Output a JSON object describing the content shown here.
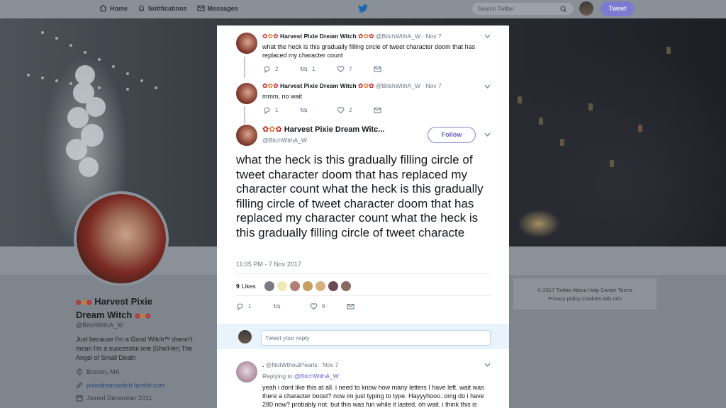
{
  "nav": {
    "home": "Home",
    "notifications": "Notifications",
    "messages": "Messages",
    "search_placeholder": "Search Twitter",
    "tweet_button": "Tweet"
  },
  "profile": {
    "name_line1": "Harvest Pixie",
    "name_line2": "Dream Witch",
    "handle": "@BitchWithA_W",
    "bio": "Just because I'm a Good Witch™ doesn't mean I'm a successful one |She/Her| The Angel of Small Death",
    "location": "Boston, MA",
    "website": "pixiedreamwitch.tumblr.com",
    "joined": "Joined December 2011"
  },
  "footer": {
    "line1": "© 2017 Twitter   About   Help Center   Terms",
    "line2": "Privacy policy   Cookies   Ads info"
  },
  "thread": [
    {
      "name": "Harvest Pixie Dream Witch",
      "meta": "@BitchWithA_W · Nov 7",
      "text": "what the heck is this gradually filling circle of tweet character doom that has replaced my character count",
      "replies": "2",
      "retweets": "1",
      "likes": "7"
    },
    {
      "name": "Harvest Pixie Dream Witch",
      "meta": "@BitchWithA_W · Nov 7",
      "text": "mmm, no wait",
      "replies": "1",
      "retweets": "",
      "likes": "2"
    }
  ],
  "main_tweet": {
    "name": "Harvest Pixie Dream Witc...",
    "handle": "@BitchWithA_W",
    "follow_label": "Follow",
    "text": "what the heck is this gradually filling circle of tweet character doom that has replaced my character count what the heck is this gradually filling circle of tweet character doom that has replaced my character count what the heck is this gradually filling circle of tweet characte",
    "timestamp": "11:05 PM - 7 Nov 2017",
    "likes_count": "9",
    "likes_label": "Likes",
    "replies": "1",
    "retweets": "",
    "likes": "9"
  },
  "reply_box": {
    "placeholder": "Tweet your reply"
  },
  "reply_tweet": {
    "name": ".",
    "meta": "@NotWthoutPearls · Nov 7",
    "replying_prefix": "Replying to",
    "replying_to": "@BitchWithA_W",
    "text": "yeah i dont like this at all. i need to know how many letters I have left. wait was there a character boost? now im just typing to type. Hayyyhooo. omg do i have 280 now? probably not. but this was fun while it lasted. oh wait. i think this is"
  },
  "colors": {
    "accent": "#6662c4",
    "tweet_button": "#7d7bd0",
    "emoji_red": "#c81e1e",
    "emoji_leaf": "#d97a2b"
  }
}
